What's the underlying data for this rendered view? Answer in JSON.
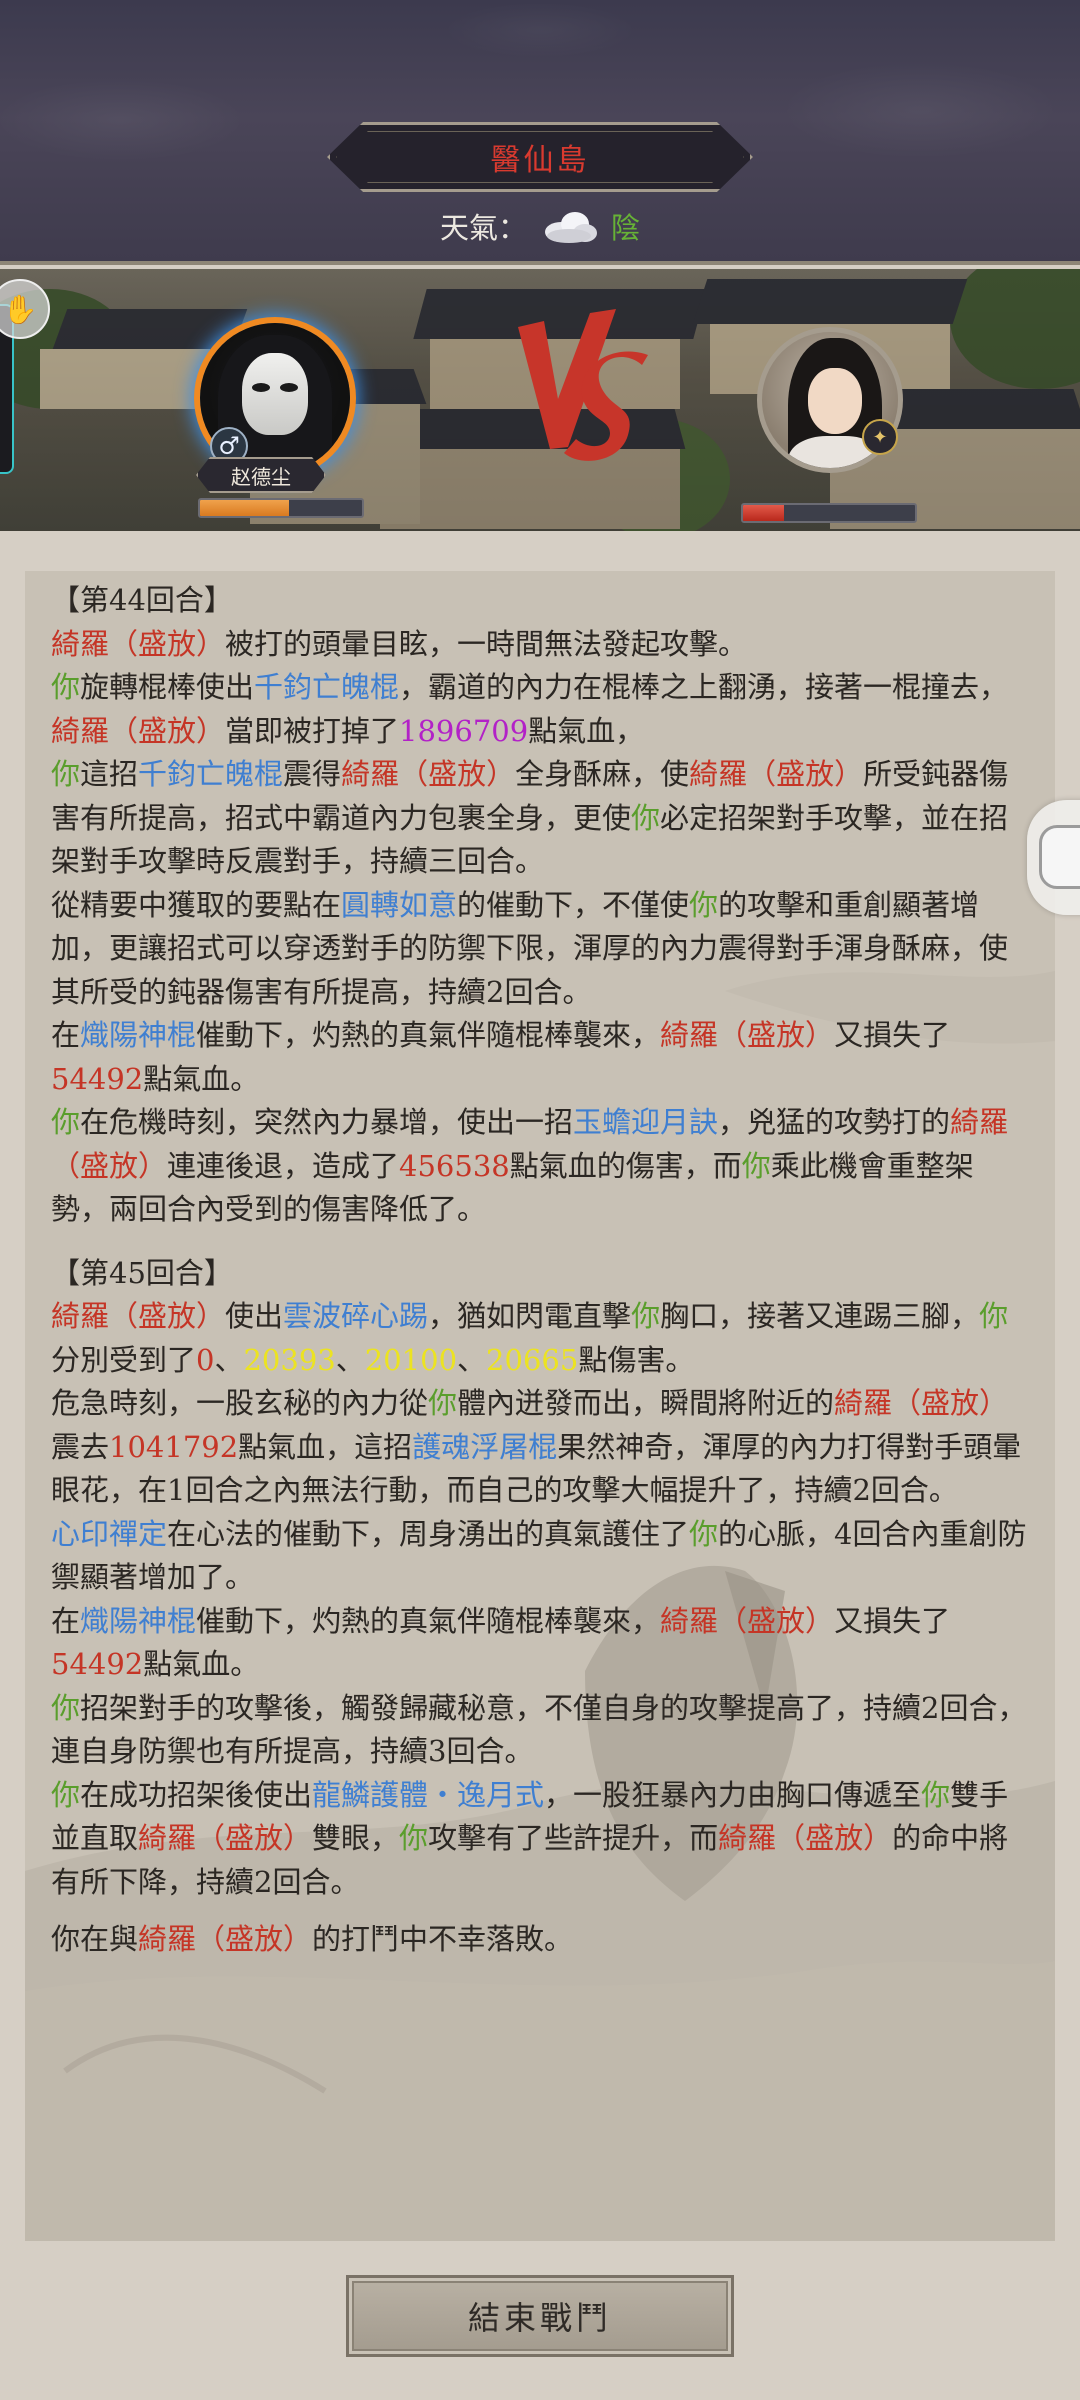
{
  "header": {
    "location_title": "醫仙島",
    "weather_label": "天氣：",
    "weather_icon": "cloud-icon",
    "weather_value": "陰"
  },
  "battle": {
    "player_name": "赵德尘",
    "player_gender_symbol": "♂",
    "player_hp_fraction": 0.55,
    "enemy_hp_fraction": 0.24,
    "vs_label": "VS",
    "side_button_icon": "hand-icon"
  },
  "log": {
    "round44_header": "【第44回合】",
    "round45_header": "【第45回合】",
    "lines": [
      [
        [
          "r",
          "綺羅（盛放）"
        ],
        [
          "n",
          "被打的頭暈目眩，一時間無法發起攻擊。"
        ]
      ],
      [
        [
          "g",
          "你"
        ],
        [
          "n",
          "旋轉棍棒使出"
        ],
        [
          "b",
          "千鈞亡魄棍"
        ],
        [
          "n",
          "，霸道的內力在棍棒之上翻湧，接著一棍撞去，"
        ],
        [
          "r",
          "綺羅（盛放）"
        ],
        [
          "n",
          "當即被打掉了"
        ],
        [
          "p",
          "1896709"
        ],
        [
          "n",
          "點氣血，"
        ]
      ],
      [
        [
          "g",
          "你"
        ],
        [
          "n",
          "這招"
        ],
        [
          "b",
          "千鈞亡魄棍"
        ],
        [
          "n",
          "震得"
        ],
        [
          "r",
          "綺羅（盛放）"
        ],
        [
          "n",
          "全身酥麻，使"
        ],
        [
          "r",
          "綺羅（盛放）"
        ],
        [
          "n",
          "所受鈍器傷害有所提高，招式中霸道內力包裹全身，更使"
        ],
        [
          "g",
          "你"
        ],
        [
          "n",
          "必定招架對手攻擊，並在招架對手攻擊時反震對手，持續三回合。"
        ]
      ],
      [
        [
          "n",
          "從精要中獲取的要點在"
        ],
        [
          "b",
          "圓轉如意"
        ],
        [
          "n",
          "的催動下，不僅使"
        ],
        [
          "g",
          "你"
        ],
        [
          "n",
          "的攻擊和重創顯著增加，更讓招式可以穿透對手的防禦下限，渾厚的內力震得對手渾身酥麻，使其所受的鈍器傷害有所提高，持續2回合。"
        ]
      ],
      [
        [
          "n",
          "在"
        ],
        [
          "b",
          "熾陽神棍"
        ],
        [
          "n",
          "催動下，灼熱的真氣伴隨棍棒襲來，"
        ],
        [
          "r",
          "綺羅（盛放）"
        ],
        [
          "n",
          "又損失了"
        ],
        [
          "r",
          "54492"
        ],
        [
          "n",
          "點氣血。"
        ]
      ],
      [
        [
          "g",
          "你"
        ],
        [
          "n",
          "在危機時刻，突然內力暴增，使出一招"
        ],
        [
          "b",
          "玉蟾迎月訣"
        ],
        [
          "n",
          "，兇猛的攻勢打的"
        ],
        [
          "r",
          "綺羅（盛放）"
        ],
        [
          "n",
          "連連後退，造成了"
        ],
        [
          "r",
          "456538"
        ],
        [
          "n",
          "點氣血的傷害，而"
        ],
        [
          "g",
          "你"
        ],
        [
          "n",
          "乘此機會重整架勢，兩回合內受到的傷害降低了。"
        ]
      ]
    ],
    "lines2": [
      [
        [
          "r",
          "綺羅（盛放）"
        ],
        [
          "n",
          "使出"
        ],
        [
          "b",
          "雲波碎心踢"
        ],
        [
          "n",
          "，猶如閃電直擊"
        ],
        [
          "g",
          "你"
        ],
        [
          "n",
          "胸口，接著又連踢三腳，"
        ],
        [
          "g",
          "你"
        ],
        [
          "n",
          "分別受到了"
        ],
        [
          "r",
          "0"
        ],
        [
          "n",
          "、"
        ],
        [
          "y",
          "20393"
        ],
        [
          "n",
          "、"
        ],
        [
          "y",
          "20100"
        ],
        [
          "n",
          "、"
        ],
        [
          "y",
          "20665"
        ],
        [
          "n",
          "點傷害。"
        ]
      ],
      [
        [
          "n",
          "危急時刻，一股玄秘的內力從"
        ],
        [
          "g",
          "你"
        ],
        [
          "n",
          "體內迸發而出，瞬間將附近的"
        ],
        [
          "r",
          "綺羅（盛放）"
        ],
        [
          "n",
          "震去"
        ],
        [
          "r",
          "1041792"
        ],
        [
          "n",
          "點氣血，這招"
        ],
        [
          "b",
          "護魂浮屠棍"
        ],
        [
          "n",
          "果然神奇，渾厚的內力打得對手頭暈眼花，在1回合之內無法行動，而自己的攻擊大幅提升了，持續2回合。"
        ]
      ],
      [
        [
          "b",
          "心印禪定"
        ],
        [
          "n",
          "在心法的催動下，周身湧出的真氣護住了"
        ],
        [
          "g",
          "你"
        ],
        [
          "n",
          "的心脈，4回合內重創防禦顯著增加了。"
        ]
      ],
      [
        [
          "n",
          "在"
        ],
        [
          "b",
          "熾陽神棍"
        ],
        [
          "n",
          "催動下，灼熱的真氣伴隨棍棒襲來，"
        ],
        [
          "r",
          "綺羅（盛放）"
        ],
        [
          "n",
          "又損失了"
        ],
        [
          "r",
          "54492"
        ],
        [
          "n",
          "點氣血。"
        ]
      ],
      [
        [
          "g",
          "你"
        ],
        [
          "n",
          "招架對手的攻擊後，觸發歸藏秘意，不僅自身的攻擊提高了，持續2回合，連自身防禦也有所提高，持續3回合。"
        ]
      ],
      [
        [
          "g",
          "你"
        ],
        [
          "n",
          "在成功招架後使出"
        ],
        [
          "b",
          "龍鱗護體・逸月式"
        ],
        [
          "n",
          "，一股狂暴內力由胸口傳遞至"
        ],
        [
          "g",
          "你"
        ],
        [
          "n",
          "雙手並直取"
        ],
        [
          "r",
          "綺羅（盛放）"
        ],
        [
          "n",
          "雙眼，"
        ],
        [
          "g",
          "你"
        ],
        [
          "n",
          "攻擊有了些許提升，而"
        ],
        [
          "r",
          "綺羅（盛放）"
        ],
        [
          "n",
          "的命中將有所下降，持續2回合。"
        ]
      ]
    ],
    "final_line": [
      [
        "n",
        "你在與"
      ],
      [
        "r",
        "綺羅（盛放）"
      ],
      [
        "n",
        "的打鬥中不幸落敗。"
      ]
    ]
  },
  "footer": {
    "end_battle_label": "結束戰鬥"
  },
  "colors": {
    "enemy_name": "#c53526",
    "player_ref": "#5a9e2c",
    "skill": "#3f7fd1",
    "big_damage": "#b221c7",
    "hit_damage": "#ece321",
    "weather": "#67b236"
  }
}
